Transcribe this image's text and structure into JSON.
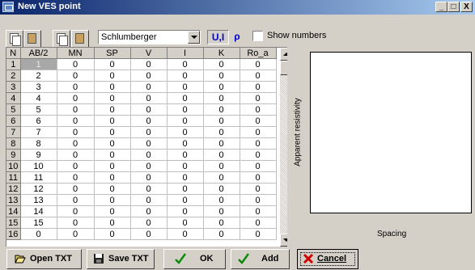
{
  "window": {
    "title": "New VES point",
    "min": "_",
    "max": "□",
    "close": "X"
  },
  "toolbar": {
    "method": "Schlumberger",
    "mode_ui": "U,I",
    "mode_rho": "ρ",
    "show_numbers": "Show numbers",
    "show_numbers_checked": false
  },
  "grid": {
    "columns": [
      "N",
      "AB/2",
      "MN",
      "SP",
      "V",
      "I",
      "K",
      "Ro_a"
    ],
    "rows": [
      [
        "1",
        "1",
        "0",
        "0",
        "0",
        "0",
        "0",
        "0"
      ],
      [
        "2",
        "2",
        "0",
        "0",
        "0",
        "0",
        "0",
        "0"
      ],
      [
        "3",
        "3",
        "0",
        "0",
        "0",
        "0",
        "0",
        "0"
      ],
      [
        "4",
        "4",
        "0",
        "0",
        "0",
        "0",
        "0",
        "0"
      ],
      [
        "5",
        "5",
        "0",
        "0",
        "0",
        "0",
        "0",
        "0"
      ],
      [
        "6",
        "6",
        "0",
        "0",
        "0",
        "0",
        "0",
        "0"
      ],
      [
        "7",
        "7",
        "0",
        "0",
        "0",
        "0",
        "0",
        "0"
      ],
      [
        "8",
        "8",
        "0",
        "0",
        "0",
        "0",
        "0",
        "0"
      ],
      [
        "9",
        "9",
        "0",
        "0",
        "0",
        "0",
        "0",
        "0"
      ],
      [
        "10",
        "10",
        "0",
        "0",
        "0",
        "0",
        "0",
        "0"
      ],
      [
        "11",
        "11",
        "0",
        "0",
        "0",
        "0",
        "0",
        "0"
      ],
      [
        "12",
        "12",
        "0",
        "0",
        "0",
        "0",
        "0",
        "0"
      ],
      [
        "13",
        "13",
        "0",
        "0",
        "0",
        "0",
        "0",
        "0"
      ],
      [
        "14",
        "14",
        "0",
        "0",
        "0",
        "0",
        "0",
        "0"
      ],
      [
        "15",
        "15",
        "0",
        "0",
        "0",
        "0",
        "0",
        "0"
      ],
      [
        "16",
        "0",
        "0",
        "0",
        "0",
        "0",
        "0",
        "0"
      ]
    ]
  },
  "plot": {
    "ylabel": "Apparent resistivity",
    "xlabel": "Spacing"
  },
  "buttons": {
    "open_txt": "Open TXT",
    "save_txt": "Save TXT",
    "ok": "OK",
    "add": "Add",
    "cancel": "Cancel"
  },
  "colors": {
    "title_start": "#0a246a",
    "title_end": "#a6caf0",
    "face": "#d4d0c8",
    "mode_text": "#0000cc"
  }
}
